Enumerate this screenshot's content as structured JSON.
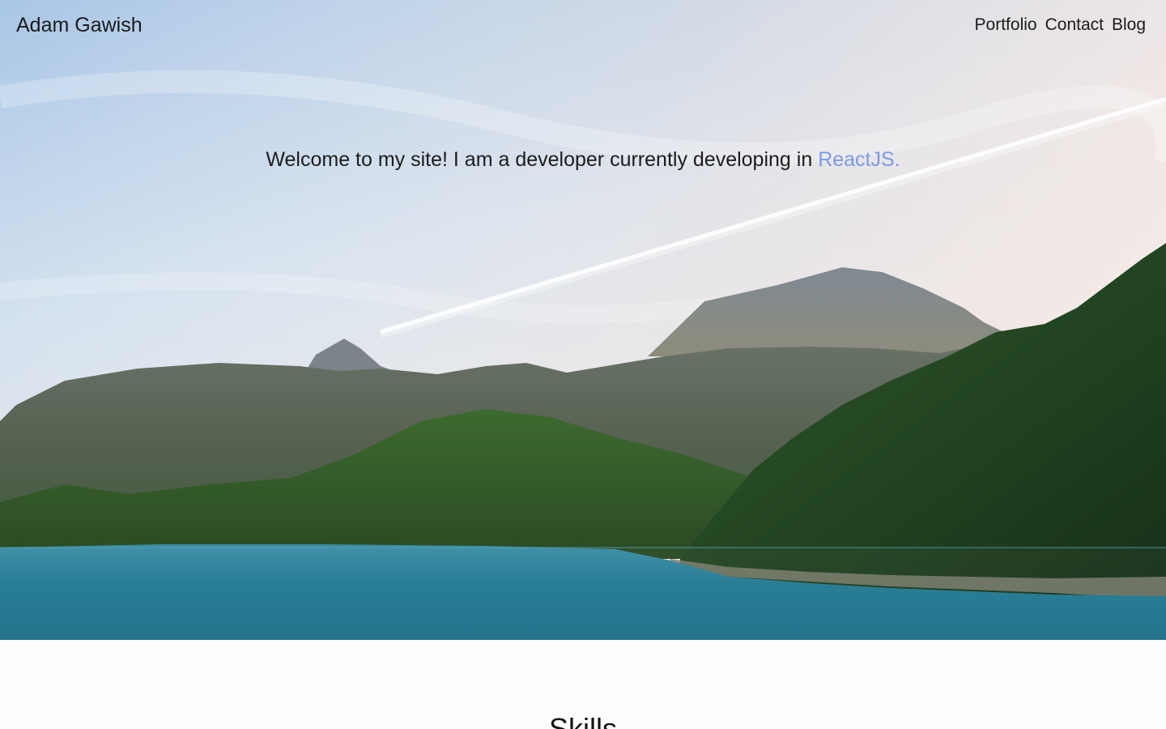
{
  "nav": {
    "brand": "Adam Gawish",
    "links": [
      "Portfolio",
      "Contact",
      "Blog"
    ]
  },
  "hero": {
    "welcome_text": "Welcome to my site! I am a developer currently developing in ",
    "welcome_accent": "ReactJS.",
    "background_image": "mountain-lake-landscape",
    "accent_color": "#7e9ae4"
  },
  "skills": {
    "heading": "Skills"
  }
}
